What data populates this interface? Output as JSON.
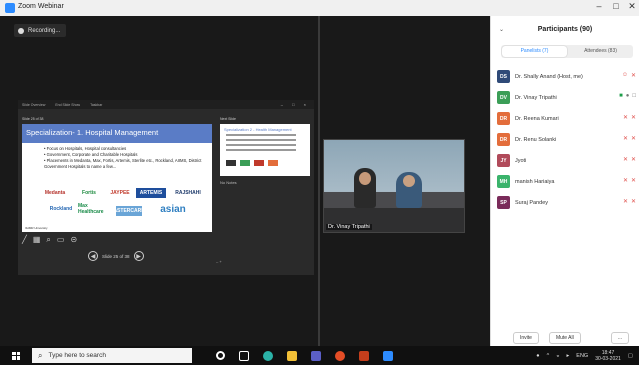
{
  "window": {
    "title": "Zoom Webinar",
    "minimize": "–",
    "maximize": "□",
    "close": "✕"
  },
  "recording": {
    "label": "Recording..."
  },
  "shared_screen": {
    "toolbar_items": [
      "Slide Overview",
      "End Slide Show",
      "Taskbar"
    ],
    "controls": "– □ ×",
    "slide_counter_top": "Slide 25 of 38",
    "next_label": "Next Slide",
    "slide": {
      "title": "Specialization- 1. Hospital Management",
      "bullets": [
        "Focus on Hospitals, Hospital consultancies",
        "Government, Corporate and Charitable Hospitals",
        "Placements in Medanta, Max, Fortis, Artemis, Sterlite etc., Rockland, AIIMS, District Government Hospitals to name a few..."
      ],
      "logos": [
        "Medanta",
        "Fortis",
        "JAYPEE",
        "ARTEMIS",
        "RAJSHAHI",
        "Rockland",
        "Max Healthcare",
        "ASTERCARE",
        "asian"
      ],
      "footer": "IIHMR University"
    },
    "next_slide": {
      "title": "Specialization 2 - Health Management"
    },
    "notes": "No Notes",
    "slide_nav": {
      "prev": "◀",
      "next": "▶",
      "label": "Slide 25 of 38"
    },
    "zoom_ctl": "– +"
  },
  "webcam": {
    "name": "Dr. Vinay Tripathi"
  },
  "participants": {
    "title": "Participants (90)",
    "tabs": [
      {
        "label": "Panelists (7)",
        "active": true
      },
      {
        "label": "Attendees (83)",
        "active": false
      }
    ],
    "list": [
      {
        "initials": "DS",
        "name": "Dr. Shally Anand (Host, me)",
        "color": "#2f4a78",
        "icons": [
          "☺",
          "✕"
        ]
      },
      {
        "initials": "DV",
        "name": "Dr. Vinay Tripathi",
        "color": "#3b9e57",
        "icons": [
          "■",
          "●",
          "□"
        ]
      },
      {
        "initials": "DR",
        "name": "Dr. Reena Kumari",
        "color": "#e36d3b",
        "icons": [
          "✕",
          "✕"
        ]
      },
      {
        "initials": "DR",
        "name": "Dr. Renu Solanki",
        "color": "#e36d3b",
        "icons": [
          "✕",
          "✕"
        ]
      },
      {
        "initials": "JY",
        "name": "Jyoti",
        "color": "#b04a5a",
        "icons": [
          "✕",
          "✕"
        ]
      },
      {
        "initials": "MH",
        "name": "manish Hariaiya",
        "color": "#3ab36b",
        "icons": [
          "✕",
          "✕"
        ]
      },
      {
        "initials": "SP",
        "name": "Suraj Pandey",
        "color": "#7a2b5a",
        "icons": [
          "✕",
          "✕"
        ]
      }
    ],
    "invite": "Invite",
    "mute_all": "Mute All",
    "more": "..."
  },
  "taskbar": {
    "search_placeholder": "Type here to search",
    "lang": "ENG",
    "time": "18:47",
    "date": "30-03-2021"
  }
}
